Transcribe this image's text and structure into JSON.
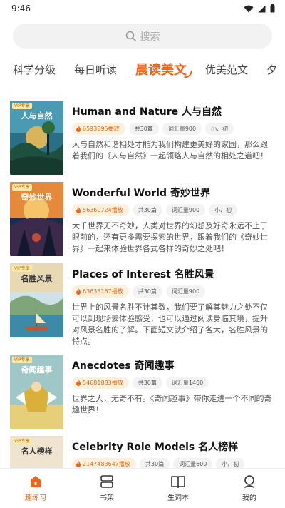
{
  "status_bar": {
    "time": "9:46"
  },
  "search": {
    "placeholder": "搜索"
  },
  "tabs": [
    {
      "label": "科学分级",
      "active": false
    },
    {
      "label": "每日听读",
      "active": false
    },
    {
      "label": "晨读美文",
      "active": true
    },
    {
      "label": "优美范文",
      "active": false
    },
    {
      "label": "夕",
      "active": false
    }
  ],
  "items": [
    {
      "cover_title": "人与自然",
      "vip": "VIP专享",
      "title": "Human and Nature 人与自然",
      "plays": "6593895播放",
      "count": "共30篇",
      "vocab": "词汇量900",
      "level": "小、初",
      "desc": "人与自然和谐相处才能为我们构建更美好的家园，那么跟着我们的《人与自然》一起领略人与自然的相处之道吧！"
    },
    {
      "cover_title": "奇妙世界",
      "vip": "VIP专享",
      "title": "Wonderful World 奇妙世界",
      "plays": "56360724播放",
      "count": "共30篇",
      "vocab": "词汇量900",
      "level": "小、初",
      "desc": "大千世界无不奇妙，人类对世界的幻想及好奇永远不止于眼前的，还有更多需要探索的世界，跟着我们的《奇妙世界》一起来体验世界各式各样的奇妙之处吧！"
    },
    {
      "cover_title": "名胜风景",
      "vip": "VIP专享",
      "title": "Places of Interest 名胜风景",
      "plays": "63638167播放",
      "count": "共30篇",
      "vocab": "词汇量900",
      "level": "",
      "desc": "世界上的风景名胜不计其数，我们要了解其魅力之处不仅可以到现场去体验感受，也可以通过阅读身临其境，提升对风景名胜的了解。下面短文就介绍了各大，名胜风景的特点。"
    },
    {
      "cover_title": "奇闻趣事",
      "vip": "VIP专享",
      "title": "Anecdotes 奇闻趣事",
      "plays": "54681883播放",
      "count": "共30篇",
      "vocab": "词汇量1400",
      "level": "",
      "desc": "世界之大，无奇不有。《奇闻趣事》带你走进一个不同的奇趣世界！"
    },
    {
      "cover_title": "名人榜样",
      "vip": "VIP专享",
      "title": "Celebrity Role Models 名人榜样",
      "plays": "2147483647播放",
      "count": "共30篇",
      "vocab": "词汇量600",
      "level": "小、初",
      "desc": ""
    }
  ],
  "bottom_nav": [
    {
      "label": "趣练习",
      "icon": "home-icon",
      "active": true
    },
    {
      "label": "书架",
      "icon": "bookshelf-icon",
      "active": false
    },
    {
      "label": "生词本",
      "icon": "book-icon",
      "active": false
    },
    {
      "label": "我的",
      "icon": "user-icon",
      "active": false
    }
  ],
  "colors": {
    "accent": "#f06318",
    "plays_bg": "#fdf0dc",
    "tag_bg": "#f3f3f3"
  }
}
